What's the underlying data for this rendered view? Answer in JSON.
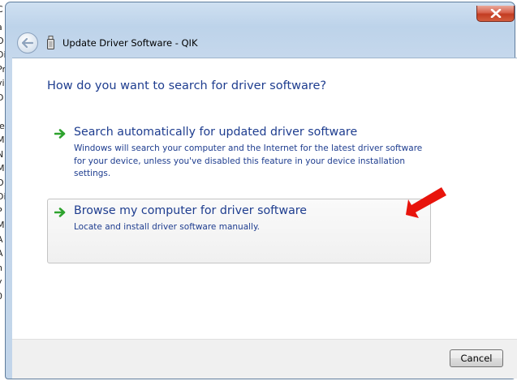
{
  "window": {
    "title": "Update Driver Software - QIK",
    "close_icon": "close-icon",
    "back_icon": "back-arrow-icon"
  },
  "content": {
    "heading": "How do you want to search for driver software?",
    "options": [
      {
        "title": "Search automatically for updated driver software",
        "description": "Windows will search your computer and the Internet for the latest driver software for your device, unless you've disabled this feature in your device installation settings.",
        "icon": "green-arrow-icon"
      },
      {
        "title": "Browse my computer for driver software",
        "description": "Locate and install driver software manually.",
        "icon": "green-arrow-icon",
        "highlighted": true
      }
    ]
  },
  "annotation": {
    "icon": "red-arrow-annotation",
    "color": "#e8140c"
  },
  "footer": {
    "cancel_label": "Cancel"
  },
  "background_fragments": [
    "C",
    "a",
    "O",
    "Di",
    "Pr",
    "vi",
    "D",
    "le",
    "M",
    "N",
    "M",
    "O",
    "Di",
    "P",
    "M",
    "A",
    "A",
    "n",
    "y",
    "0"
  ],
  "colors": {
    "link_blue": "#1e3d8f",
    "arrow_green": "#2ea32e",
    "frame_blue": "#c2d5ea"
  }
}
